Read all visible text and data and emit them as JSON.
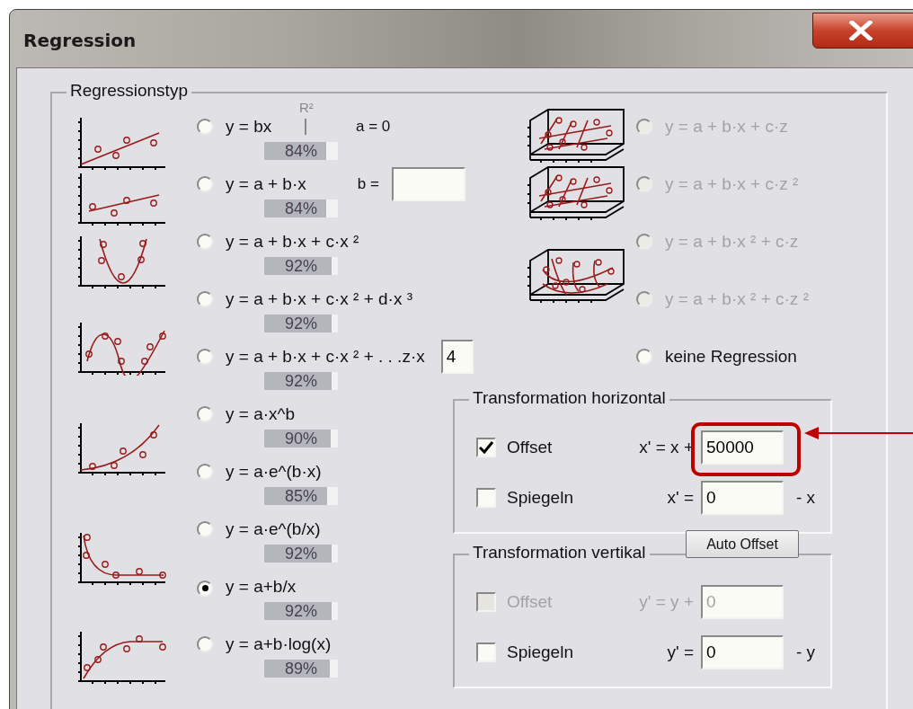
{
  "window": {
    "title": "Regression"
  },
  "regression": {
    "title": "Regressionstyp",
    "r2_header": "R²",
    "left": [
      {
        "formula": "y = bx",
        "selected": false,
        "r2": "84%",
        "level": 0.84,
        "kind": "line-origin",
        "extra": {
          "kind": "text",
          "text": "a = 0"
        }
      },
      {
        "formula": "y = a + b·x",
        "selected": false,
        "r2": "84%",
        "level": 0.84,
        "kind": "line",
        "extra": {
          "kind": "input",
          "label": "b ="
        }
      },
      {
        "formula": "y = a + b·x + c·x ²",
        "selected": false,
        "r2": "92%",
        "level": 0.92,
        "kind": "parabola"
      },
      {
        "formula": "y = a + b·x + c·x ² + d·x ³",
        "selected": false,
        "r2": "92%",
        "level": 0.92
      },
      {
        "formula": "y = a + b·x + c·x ² + . . .z·x",
        "selected": false,
        "r2": "92%",
        "level": 0.92,
        "kind": "wave",
        "extra": {
          "kind": "spin",
          "value": "4"
        }
      },
      {
        "formula": "y = a·x^b",
        "selected": false,
        "r2": "90%",
        "level": 0.9,
        "kind": "power"
      },
      {
        "formula": "y = a·e^(b·x)",
        "selected": false,
        "r2": "85%",
        "level": 0.85
      },
      {
        "formula": "y = a·e^(b/x)",
        "selected": false,
        "r2": "92%",
        "level": 0.92,
        "kind": "hyperbola"
      },
      {
        "formula": "y = a+b/x",
        "selected": true,
        "r2": "92%",
        "level": 0.92
      },
      {
        "formula": "y = a+b·log(x)",
        "selected": false,
        "r2": "89%",
        "level": 0.89,
        "kind": "log"
      }
    ],
    "right": [
      {
        "formula": "y = a + b·x + c·z",
        "selected": false,
        "disabled": true,
        "kind": "plane"
      },
      {
        "formula": "y = a + b·x + c·z ²",
        "selected": false,
        "disabled": true,
        "kind": "plane"
      },
      {
        "formula": "y = a + b·x ² + c·z",
        "selected": false,
        "disabled": true,
        "kind": "surface"
      },
      {
        "formula": "y = a + b·x ² + c·z ²",
        "selected": false,
        "disabled": true
      },
      {
        "formula": "keine Regression",
        "selected": false,
        "disabled": false
      }
    ]
  },
  "transforms": [
    {
      "title": "Transformation horizontal",
      "rows": [
        {
          "label": "Offset",
          "checked": true,
          "disabled": false,
          "formula": "x' = x +",
          "value": "50000",
          "highlighted": true
        },
        {
          "label": "Spiegeln",
          "checked": false,
          "disabled": false,
          "formula": "x' =",
          "value": "0",
          "suffix": "- x",
          "highlighted": false
        }
      ]
    },
    {
      "title": "Transformation vertikal",
      "rows": [
        {
          "label": "Offset",
          "checked": false,
          "disabled": true,
          "formula": "y' = y +",
          "value": "0",
          "highlighted": false
        },
        {
          "label": "Spiegeln",
          "checked": false,
          "disabled": false,
          "formula": "y' =",
          "value": "0",
          "suffix": "- y",
          "highlighted": false
        }
      ]
    }
  ],
  "auto_offset_button": "Auto Offset"
}
